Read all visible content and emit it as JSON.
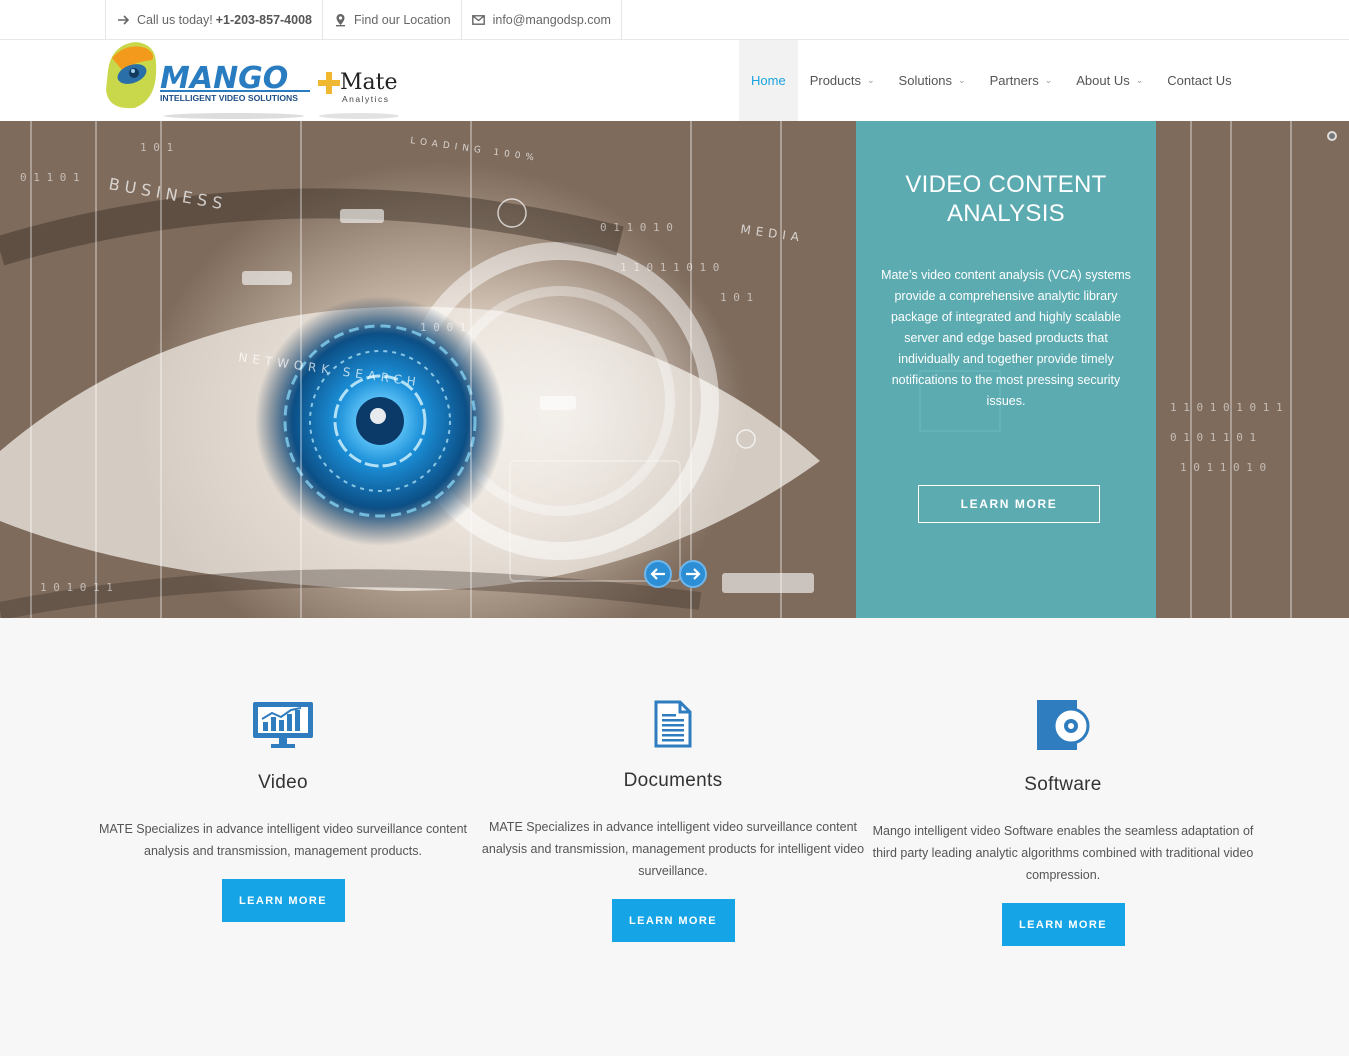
{
  "topbar": {
    "call_label": "Call us today!",
    "phone": "+1-203-857-4008",
    "location": "Find our Location",
    "email": "info@mangodsp.com"
  },
  "logo": {
    "brand": "MANGO",
    "tagline": "INTELLIGENT VIDEO SOLUTIONS",
    "partner": "Mate",
    "partner_sub": "Analytics"
  },
  "nav": {
    "items": [
      {
        "label": "Home",
        "active": true
      },
      {
        "label": "Products",
        "dropdown": true
      },
      {
        "label": "Solutions",
        "dropdown": true
      },
      {
        "label": "Partners",
        "dropdown": true
      },
      {
        "label": "About Us",
        "dropdown": true
      },
      {
        "label": "Contact Us"
      }
    ]
  },
  "hero": {
    "title_line1": "VIDEO CONTENT",
    "title_line2": "ANALYSIS",
    "text": "Mate’s video content analysis (VCA) systems provide a comprehensive analytic library package of integrated and highly scalable server and edge based products that individually and together provide timely notifications to the most pressing security issues.",
    "button": "LEARN MORE",
    "bg_words": [
      "BUSINESS",
      "NETWORK SEARCH",
      "MEDIA",
      "LOADING 100%"
    ]
  },
  "features": [
    {
      "icon": "monitor-chart-icon",
      "title": "Video",
      "text": "MATE Specializes in advance intelligent video surveillance content analysis and  transmission, management products.",
      "button": "LEARN MORE"
    },
    {
      "icon": "document-icon",
      "title": "Documents",
      "text": "MATE Specializes in advance intelligent video surveillance content analysis and  transmission, management products for intelligent video surveillance.",
      "button": "LEARN MORE"
    },
    {
      "icon": "software-disc-icon",
      "title": "Software",
      "text": "Mango intelligent video Software enables the seamless adaptation of third party leading analytic algorithms combined with traditional video compression.",
      "button": "LEARN MORE"
    }
  ],
  "colors": {
    "accent": "#15a4e6",
    "panel": "#54bac4",
    "icon_blue": "#2f7dbf"
  }
}
